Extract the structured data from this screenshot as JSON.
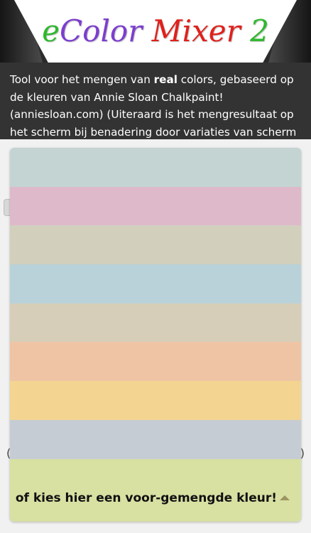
{
  "header": {
    "logo_letters": [
      {
        "char": "e",
        "color": "#2db82d"
      },
      {
        "char": "C",
        "color": "#7c3ecf"
      },
      {
        "char": "o",
        "color": "#7c3ecf"
      },
      {
        "char": "l",
        "color": "#7c3ecf"
      },
      {
        "char": "o",
        "color": "#7c3ecf"
      },
      {
        "char": "r",
        "color": "#7c3ecf"
      },
      {
        "char": " ",
        "color": "#000000"
      },
      {
        "char": "M",
        "color": "#e0201c"
      },
      {
        "char": "i",
        "color": "#e0201c"
      },
      {
        "char": "x",
        "color": "#e0201c"
      },
      {
        "char": "e",
        "color": "#e0201c"
      },
      {
        "char": "r",
        "color": "#e0201c"
      },
      {
        "char": " ",
        "color": "#000000"
      },
      {
        "char": "2",
        "color": "#2db82d"
      }
    ]
  },
  "intro": {
    "part1": "Tool voor het mengen van ",
    "bold": "real",
    "part2": " colors, gebaseerd op de kleuren van Annie Sloan Chalkpaint! (anniesloan.com) (Uiteraard is het mengresultaat op het scherm bij benadering door variaties van scherm instellingen)"
  },
  "parens": {
    "left": "(",
    "right": ")"
  },
  "swatches": [
    {
      "color": "#c3d4d3"
    },
    {
      "color": "#deb9ca"
    },
    {
      "color": "#d2d0bd"
    },
    {
      "color": "#b9d2d9"
    },
    {
      "color": "#d6ceb8"
    },
    {
      "color": "#efc4a5"
    },
    {
      "color": "#f3d591"
    },
    {
      "color": "#c5ccd4"
    }
  ],
  "picker": {
    "label": "of kies hier een voor-gemengde kleur!",
    "icon": "triangle-up-icon"
  }
}
